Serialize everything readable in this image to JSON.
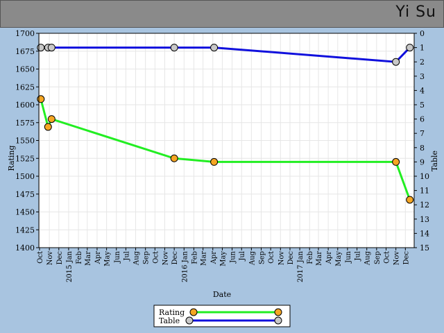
{
  "header": {
    "player_name": "Yi Su"
  },
  "chart_data": {
    "type": "line",
    "xlabel": "Date",
    "ylabel": "Rating",
    "y2label": "Table",
    "ylim": [
      1400,
      1700
    ],
    "y2lim": [
      0,
      15
    ],
    "y2_inverted": true,
    "yticks": [
      1400,
      1425,
      1450,
      1475,
      1500,
      1525,
      1550,
      1575,
      1600,
      1625,
      1650,
      1675,
      1700
    ],
    "y2ticks": [
      0,
      1,
      2,
      3,
      4,
      5,
      6,
      7,
      8,
      9,
      10,
      11,
      12,
      13,
      14,
      15
    ],
    "grid": true,
    "legend_position": "bottom-center",
    "x_month_labels": [
      "Oct",
      "Nov",
      "Dec",
      "2015 Jan",
      "Feb",
      "Mar",
      "Apr",
      "May",
      "Jun",
      "Jul",
      "Aug",
      "Sep",
      "Oct",
      "Nov",
      "Dec",
      "2016 Jan",
      "Feb",
      "Mar",
      "Apr",
      "May",
      "Jun",
      "Jul",
      "Aug",
      "Sep",
      "Oct",
      "Nov",
      "Dec",
      "2017 Jan",
      "Feb",
      "Mar",
      "Apr",
      "May",
      "Jun",
      "Jul",
      "Aug",
      "Sep",
      "Oct",
      "Nov",
      "Dec"
    ],
    "series": [
      {
        "name": "Rating",
        "axis": "left",
        "color": "#22ee22",
        "marker_color": "#f5a623",
        "x": [
          "2014-10-05",
          "2014-10-28",
          "2014-11-08",
          "2015-12-01",
          "2016-04-05",
          "2017-11-01",
          "2017-12-15"
        ],
        "values": [
          1608,
          1569,
          1580,
          1525,
          1520,
          1520,
          1467
        ]
      },
      {
        "name": "Table",
        "axis": "right",
        "color": "#1010dd",
        "marker_color": "#c8c8c8",
        "x": [
          "2014-10-05",
          "2014-10-28",
          "2014-11-08",
          "2015-12-01",
          "2016-04-05",
          "2017-11-01",
          "2017-12-15"
        ],
        "values": [
          1,
          1,
          1,
          1,
          1,
          2,
          1
        ]
      }
    ]
  }
}
